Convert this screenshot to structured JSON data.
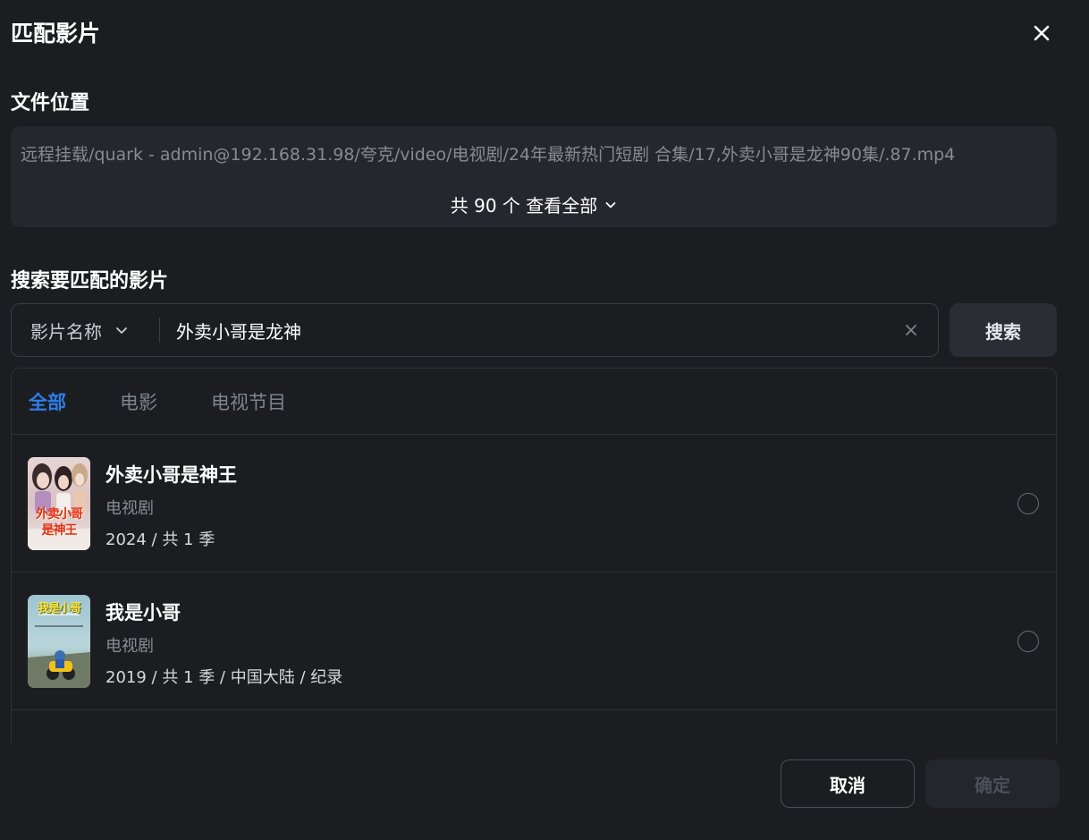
{
  "dialog": {
    "title": "匹配影片",
    "close_icon": "close-icon"
  },
  "file_location": {
    "title": "文件位置",
    "path": "远程挂载/quark - admin@192.168.31.98/夸克/video/电视剧/24年最新热门短剧 合集/17,外卖小哥是龙神90集/.87.mp4",
    "view_all_label": "共 90 个 查看全部"
  },
  "search": {
    "title": "搜索要匹配的影片",
    "type_selected": "影片名称",
    "query": "外卖小哥是龙神",
    "button_label": "搜索"
  },
  "tabs": [
    {
      "label": "全部",
      "active": true
    },
    {
      "label": "电影",
      "active": false
    },
    {
      "label": "电视节目",
      "active": false
    }
  ],
  "results": [
    {
      "title": "外卖小哥是神王",
      "type": "电视剧",
      "meta": "2024 / 共 1 季",
      "poster_text": [
        "外卖小哥",
        "是神王"
      ],
      "selected": false
    },
    {
      "title": "我是小哥",
      "type": "电视剧",
      "meta": "2019 / 共 1 季 / 中国大陆 / 纪录",
      "poster_text": [
        "我是小哥"
      ],
      "selected": false
    }
  ],
  "footer": {
    "cancel_label": "取消",
    "confirm_label": "确定"
  },
  "colors": {
    "background": "#1b1d21",
    "panel": "#24272d",
    "accent": "#2f7de9",
    "muted_text": "#868b93"
  }
}
